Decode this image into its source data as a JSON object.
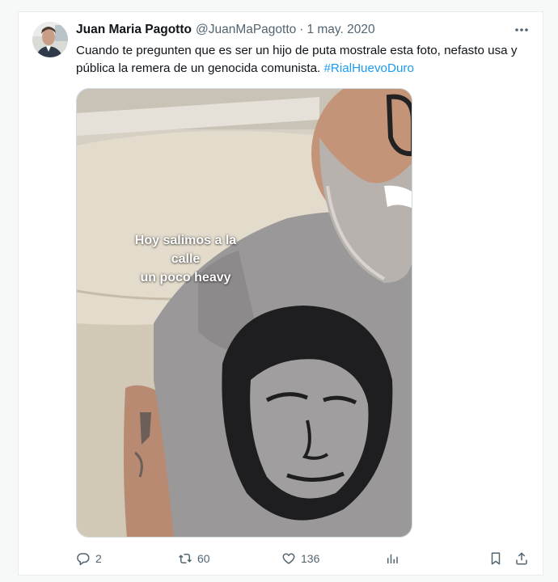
{
  "tweet": {
    "author_name": "Juan Maria Pagotto",
    "author_handle": "@JuanMaPagotto",
    "separator": "·",
    "timestamp": "1 may. 2020",
    "text": "Cuando te pregunten que es ser un hijo de puta mostrale esta foto, nefasto usa y pública la remera de un genocida comunista. ",
    "hashtag": "#RialHuevoDuro",
    "media_caption_line1": "Hoy salimos a la calle",
    "media_caption_line2": "un poco heavy"
  },
  "actions": {
    "reply_count": "2",
    "retweet_count": "60",
    "like_count": "136"
  },
  "colors": {
    "link": "#1d9bf0",
    "secondary_text": "#536471",
    "primary_text": "#0f1419"
  },
  "icons": [
    "more-icon",
    "reply-icon",
    "retweet-icon",
    "like-icon",
    "views-icon",
    "bookmark-icon",
    "share-icon"
  ]
}
